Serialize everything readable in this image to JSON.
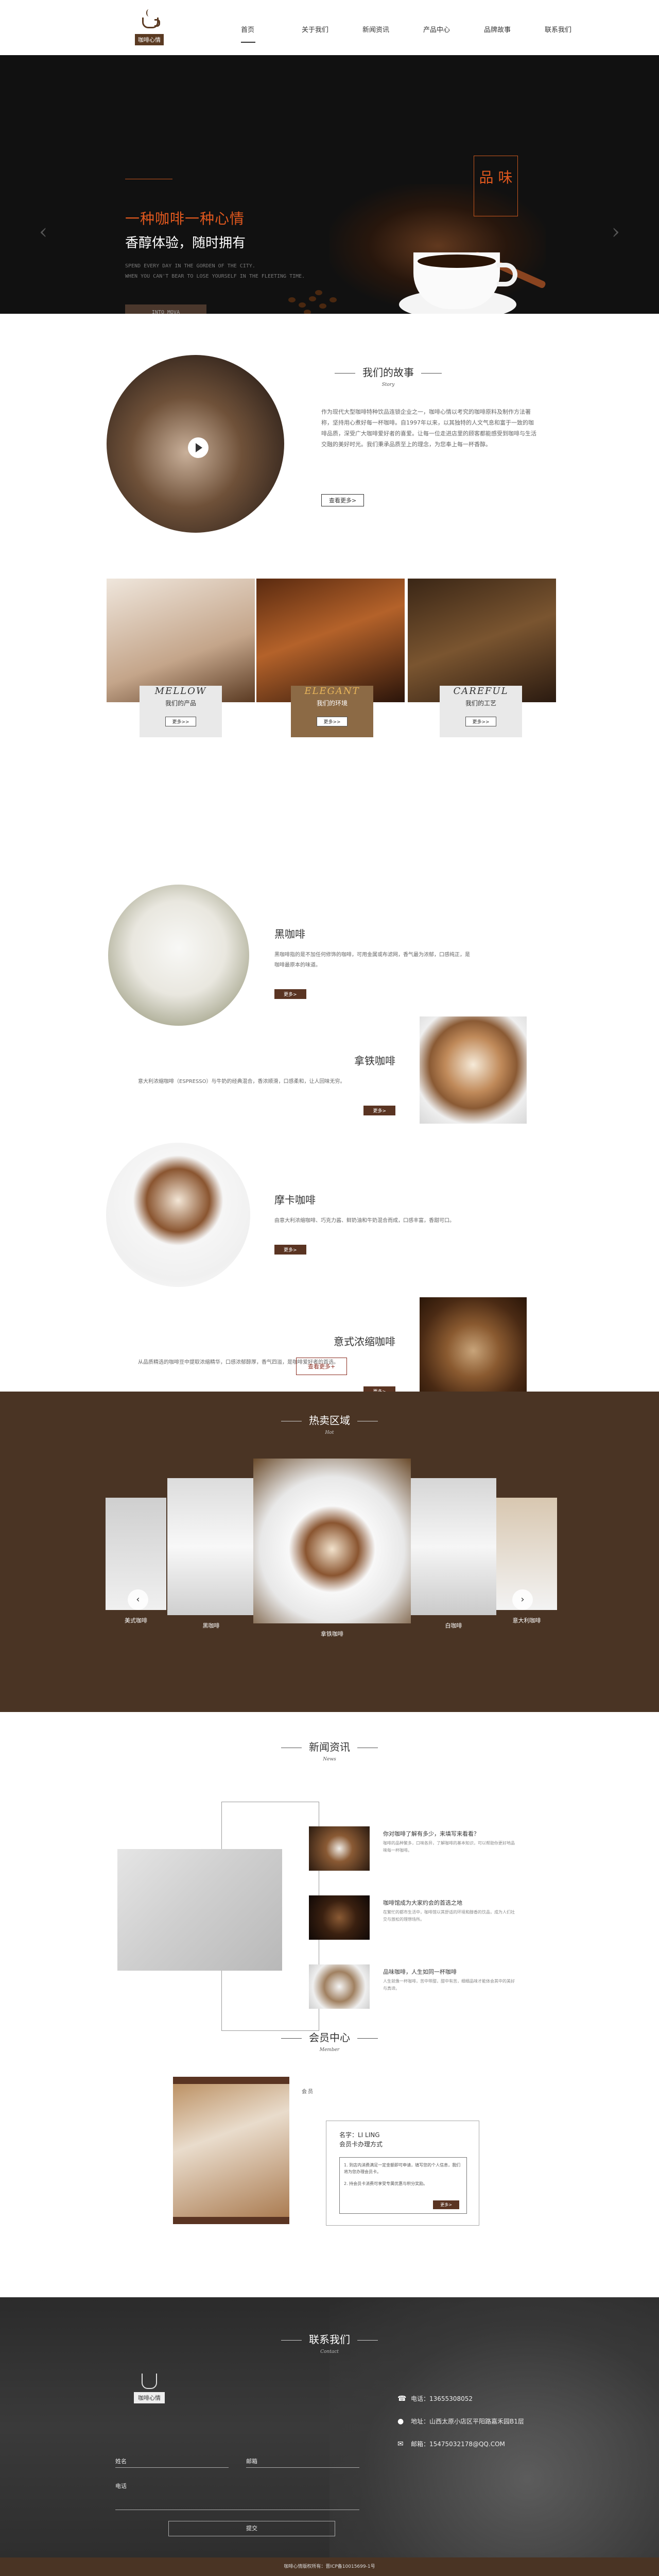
{
  "header": {
    "logo_text": "咖啡心情",
    "nav": [
      "首页",
      "关于我们",
      "新闻资讯",
      "产品中心",
      "品牌故事",
      "联系我们"
    ]
  },
  "banner": {
    "headline": "一种咖啡一种心情",
    "subheadline": "香醇体验，随时拥有",
    "english_1": "SPEND EVERY DAY IN THE GORDEN OF THE CITY.",
    "english_2": "WHEN YOU CAN'T BEAR TO LOSE YOURSELF IN THE FLEETING TIME.",
    "button": "INTO MOVA",
    "stamp": "品 味",
    "prev": "‹",
    "next": "›"
  },
  "story": {
    "title": "我们的故事",
    "subtitle": "Story",
    "text": "作为现代大型咖啡特种饮品连锁企业之一，咖啡心情以考究的咖啡原料及制作方法著称，坚持用心煮好每一杯咖啡。自1997年以来，以其独特的人文气息和富于一致的咖啡品质，深受广大咖啡爱好者的喜爱。让每一位走进店里的顾客都能感受到咖啡与生活交融的美好时光。我们秉承品质至上的理念，为您奉上每一杯香醇。",
    "more": "查看更多>"
  },
  "panels": [
    {
      "en": "MELLOW",
      "cn": "我们的产品",
      "btn": "更多>>"
    },
    {
      "en": "ELEGANT",
      "cn": "我们的环境",
      "btn": "更多>>"
    },
    {
      "en": "CAREFUL",
      "cn": "我们的工艺",
      "btn": "更多>>"
    }
  ],
  "products": [
    {
      "name": "黑咖啡",
      "desc": "黑咖啡指的是不加任何修饰的咖啡，可用金属或布滤网，香气最为浓郁，口感纯正，是咖啡最原本的味道。",
      "btn": "更多>"
    },
    {
      "name": "拿铁咖啡",
      "desc": "意大利浓缩咖啡（ESPRESSO）与牛奶的经典混合，香浓顺滑，口感柔和，让人回味无穷。",
      "btn": "更多>"
    },
    {
      "name": "摩卡咖啡",
      "desc": "由意大利浓缩咖啡、巧克力酱、鲜奶油和牛奶混合而成，口感丰富，香甜可口。",
      "btn": "更多>"
    },
    {
      "name": "意式浓缩咖啡",
      "desc": "从品质精选的咖啡豆中提取浓缩精华，口感浓郁醇厚，香气四溢，是咖啡爱好者的首选。",
      "btn": "更多>"
    }
  ],
  "products_more": "查看更多+",
  "hot": {
    "title": "热卖区域",
    "subtitle": "Hot",
    "items": [
      "美式咖啡",
      "黑咖啡",
      "拿铁咖啡",
      "白咖啡",
      "意大利咖啡"
    ],
    "prev": "‹",
    "next": "›"
  },
  "news": {
    "title": "新闻资讯",
    "subtitle": "News",
    "items": [
      {
        "title": "你对咖啡了解有多少，来填写来看看？",
        "desc": "咖啡的品种繁多，口味各异，了解咖啡的基本知识，可以帮助你更好地品味每一杯咖啡。"
      },
      {
        "title": "咖啡馆成为大家约会的首选之地",
        "desc": "在繁忙的都市生活中，咖啡馆以其舒适的环境和醇香的饮品，成为人们社交与放松的理想场所。"
      },
      {
        "title": "品味咖啡，人生如同一杯咖啡",
        "desc": "人生就像一杯咖啡，苦中带甜，甜中有苦，细细品味才能体会其中的美好与真谛。"
      }
    ]
  },
  "member": {
    "title": "会员中心",
    "subtitle": "Member",
    "name": "名字：LI LING",
    "method": "会员卡办理方式",
    "step1": "1. 到店内消费满足一定金额即可申请，填写您的个人信息，我们将为您办理会员卡。",
    "step2": "2. 持会员卡消费可享受专属优惠与积分奖励。",
    "btn": "更多>",
    "corner": "会员"
  },
  "contact": {
    "title": "联系我们",
    "subtitle": "Contact",
    "logo_text": "咖啡心情",
    "phone": "电话：13655308052",
    "address": "地址：山西太原小店区平阳路嘉禾园B1层",
    "email": "邮箱：15475032178@QQ.COM",
    "name_label": "姓名",
    "email_label": "邮箱",
    "msg_label": "电话",
    "submit": "提交"
  },
  "footer": {
    "text": "咖啡心情版权所有：晋ICP备10015699-1号"
  }
}
